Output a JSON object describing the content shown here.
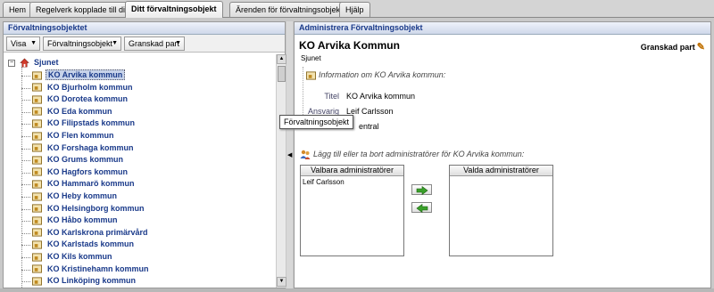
{
  "tabs": [
    {
      "label": "Hem",
      "active": false
    },
    {
      "label": "Regelverk kopplade till dig",
      "active": false
    },
    {
      "label": "Ditt förvaltningsobjekt",
      "active": true
    },
    {
      "label": "Ärenden för förvaltningsobjekt",
      "active": false
    },
    {
      "label": "Hjälp",
      "active": false
    }
  ],
  "left_panel": {
    "title": "Förvaltningsobjektet",
    "toolbar": {
      "visa": "Visa",
      "type": "Förvaltningsobjekt",
      "filter": "Granskad part"
    },
    "tree": {
      "root": "Sjunet",
      "items": [
        "KO Arvika kommun",
        "KO Bjurholm kommun",
        "KO Dorotea kommun",
        "KO Eda kommun",
        "KO Filipstads kommun",
        "KO Flen kommun",
        "KO Forshaga kommun",
        "KO Grums kommun",
        "KO Hagfors kommun",
        "KO Hammarö kommun",
        "KO Heby kommun",
        "KO Helsingborg kommun",
        "KO Håbo kommun",
        "KO Karlskrona primärvård",
        "KO Karlstads kommun",
        "KO Kils kommun",
        "KO Kristinehamn kommun",
        "KO Linköping kommun"
      ],
      "selected_index": 0
    }
  },
  "tooltip": "Förvaltningsobjekt",
  "right_panel": {
    "title": "Administrera Förvaltningsobjekt",
    "object_title": "KO Arvika Kommun",
    "object_sub": "Sjunet",
    "status": "Granskad part",
    "info_heading": "Information om KO Arvika kommun:",
    "fields": {
      "titel_label": "Titel",
      "titel_value": "KO Arvika kommun",
      "ansvarig_label": "Ansvarig",
      "ansvarig_value": "Leif Carlsson",
      "third_value": "entral"
    },
    "admin_heading": "Lägg till eller ta bort administratörer för KO Arvika kommun:",
    "available_header": "Valbara administratörer",
    "available_items": [
      "Leif Carlsson"
    ],
    "selected_header": "Valda administratörer",
    "selected_items": []
  },
  "colors": {
    "link_blue": "#1a3a8a",
    "move_green": "#3aa02a"
  }
}
